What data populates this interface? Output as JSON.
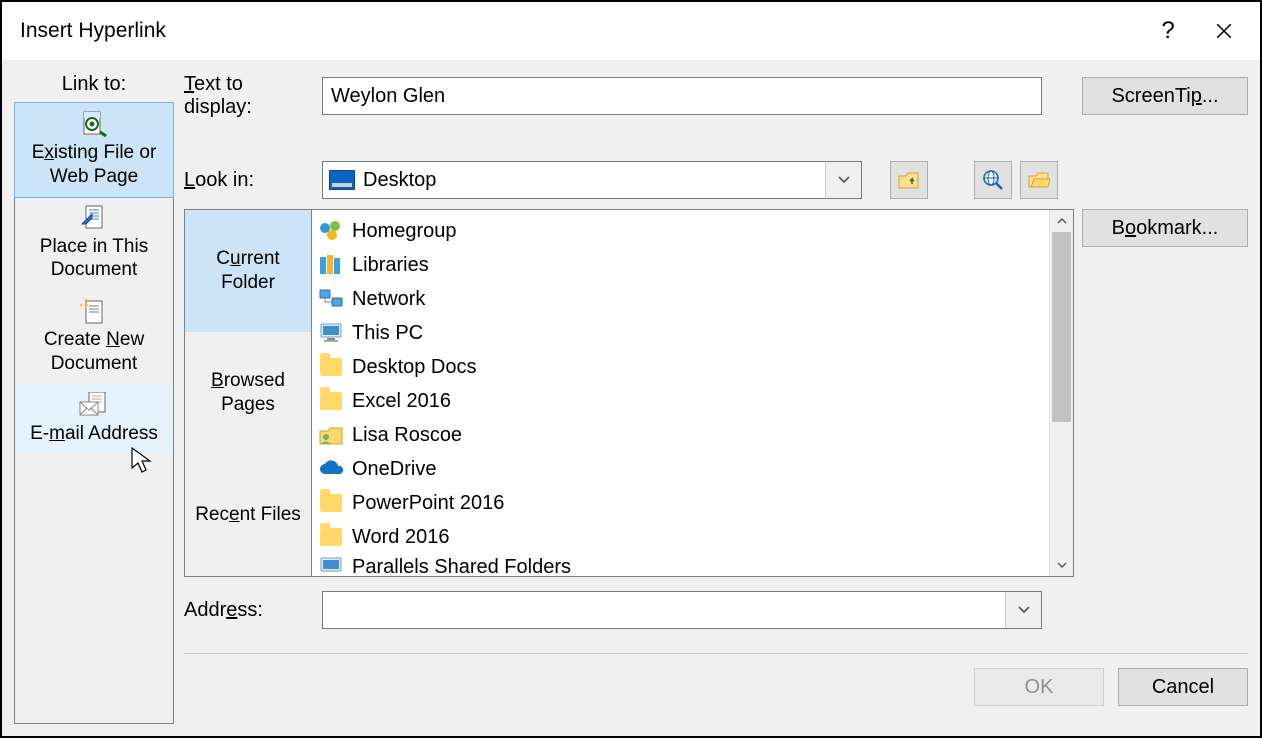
{
  "title": "Insert Hyperlink",
  "sidebar": {
    "label": "Link to:",
    "items": [
      {
        "line1": "Existing File or",
        "line2": "Web Page",
        "accel": "x"
      },
      {
        "line1": "Place in This",
        "line2": "Document",
        "accel": ""
      },
      {
        "line1": "Create New",
        "line2": "Document",
        "accel": "N"
      },
      {
        "line1": "E-mail Address",
        "line2": "",
        "accel": "m"
      }
    ]
  },
  "text_to_display": {
    "label": "Text to display:",
    "value": "Weylon Glen",
    "accel": "T"
  },
  "screentip_label": "ScreenTip...",
  "look_in": {
    "label": "Look in:",
    "value": "Desktop",
    "accel": "L"
  },
  "toolbar": {
    "up": "up-one-level",
    "search": "browse-web",
    "browse_file": "browse-file"
  },
  "tabs": [
    {
      "line1": "Current",
      "line2": "Folder",
      "accel": "u",
      "selected": true
    },
    {
      "line1": "Browsed",
      "line2": "Pages",
      "accel": "B",
      "selected": false
    },
    {
      "line1": "Recent Files",
      "line2": "",
      "accel": "e",
      "selected": false
    }
  ],
  "files": [
    {
      "name": "Homegroup",
      "icon": "homegroup"
    },
    {
      "name": "Libraries",
      "icon": "libraries"
    },
    {
      "name": "Network",
      "icon": "network"
    },
    {
      "name": "This PC",
      "icon": "thispc"
    },
    {
      "name": "Desktop Docs",
      "icon": "folder"
    },
    {
      "name": "Excel 2016",
      "icon": "folder"
    },
    {
      "name": "Lisa Roscoe",
      "icon": "user-folder"
    },
    {
      "name": "OneDrive",
      "icon": "onedrive"
    },
    {
      "name": "PowerPoint 2016",
      "icon": "folder"
    },
    {
      "name": "Word 2016",
      "icon": "folder"
    },
    {
      "name": "Parallels Shared Folders",
      "icon": "thispc"
    }
  ],
  "bookmark_label": "Bookmark...",
  "address": {
    "label": "Address:",
    "value": "",
    "accel": "e"
  },
  "buttons": {
    "ok": "OK",
    "cancel": "Cancel"
  }
}
